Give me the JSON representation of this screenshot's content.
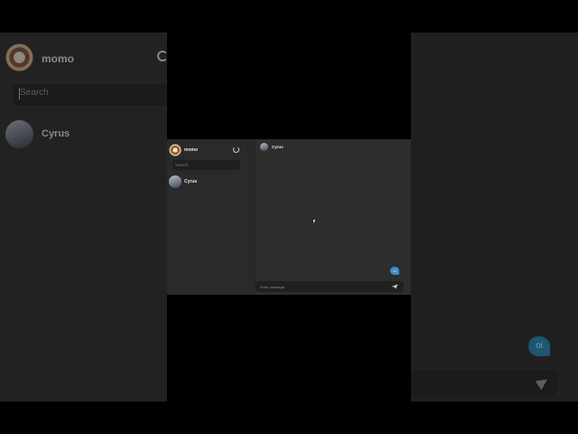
{
  "user": {
    "name": "momo",
    "avatar_icon": "user-avatar-icon"
  },
  "sidebar": {
    "refresh_icon": "refresh-icon",
    "search": {
      "placeholder": "Search",
      "value": ""
    },
    "contacts": [
      {
        "name": "Cyrus",
        "avatar_icon": "contact-avatar-icon"
      }
    ]
  },
  "chat": {
    "header": {
      "name": "Cyrus"
    },
    "messages": [
      {
        "text": "oi",
        "from": "me"
      }
    ],
    "input": {
      "placeholder": "Enter message",
      "value": ""
    },
    "send_icon": "send-icon"
  },
  "colors": {
    "window_bg": "#2b2b2b",
    "sidebar_bg": "#2a2a2a",
    "input_bg": "#1f1f1f",
    "bubble_bg": "#3b8fc4",
    "text": "#e8e8e8",
    "page_bg": "#000000"
  }
}
